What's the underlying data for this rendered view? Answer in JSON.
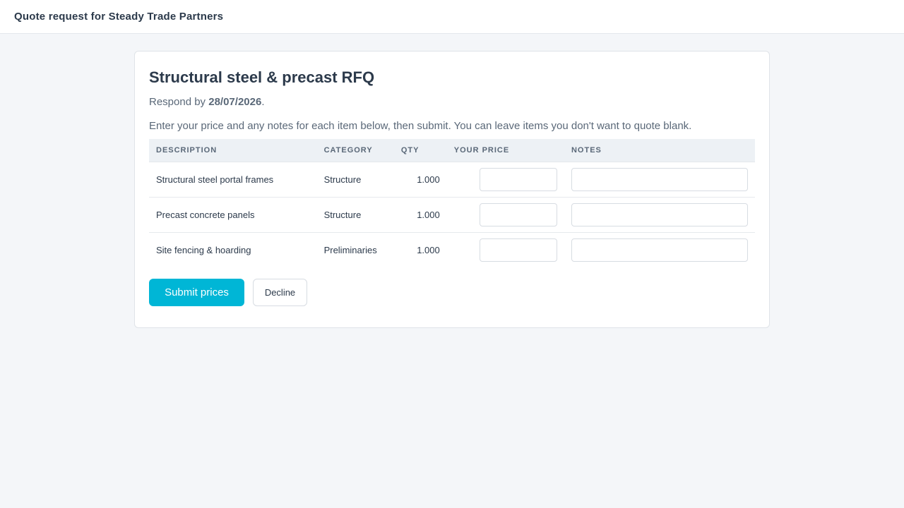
{
  "header": {
    "title": "Quote request for Steady Trade Partners"
  },
  "rfq": {
    "title": "Structural steel & precast RFQ",
    "respond_prefix": "Respond by ",
    "respond_date": "28/07/2026",
    "respond_suffix": ".",
    "instructions": "Enter your price and any notes for each item below, then submit. You can leave items you don't want to quote blank."
  },
  "table": {
    "columns": {
      "description": "DESCRIPTION",
      "category": "CATEGORY",
      "qty": "QTY",
      "price": "YOUR PRICE",
      "notes": "NOTES"
    },
    "rows": [
      {
        "description": "Structural steel portal frames",
        "category": "Structure",
        "qty": "1.000",
        "price": "",
        "notes": ""
      },
      {
        "description": "Precast concrete panels",
        "category": "Structure",
        "qty": "1.000",
        "price": "",
        "notes": ""
      },
      {
        "description": "Site fencing & hoarding",
        "category": "Preliminaries",
        "qty": "1.000",
        "price": "",
        "notes": ""
      }
    ]
  },
  "actions": {
    "submit_label": "Submit prices",
    "decline_label": "Decline"
  },
  "colors": {
    "accent": "#00b6d6",
    "text": "#2c3a4b",
    "muted": "#5a6878",
    "background": "#f4f6f9"
  }
}
